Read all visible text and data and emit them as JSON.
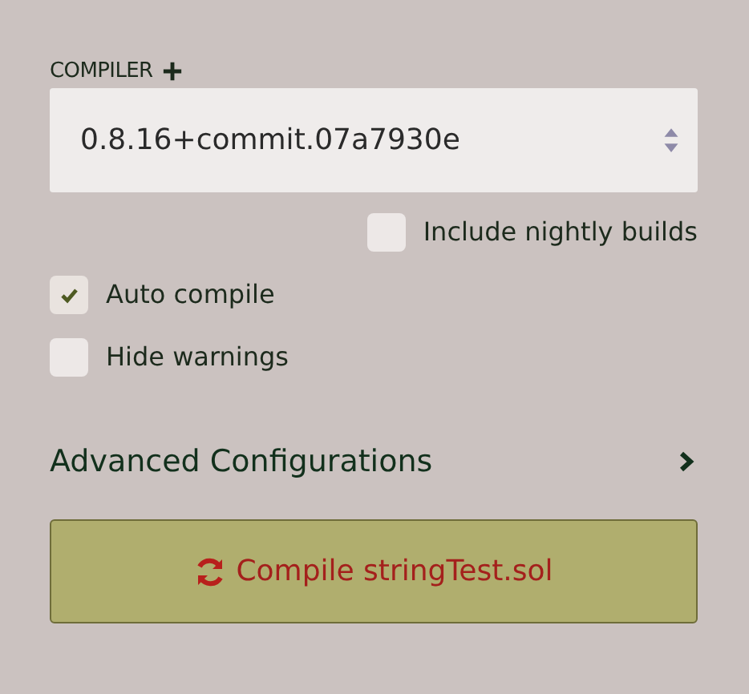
{
  "compiler": {
    "label": "COMPILER",
    "version": "0.8.16+commit.07a7930e"
  },
  "options": [
    {
      "label": "Include nightly builds",
      "checked": false,
      "kind": "aside"
    },
    {
      "label": "Auto compile",
      "checked": true,
      "kind": "main"
    },
    {
      "label": "Hide warnings",
      "checked": false,
      "kind": "main"
    }
  ],
  "advanced": {
    "label": "Advanced Configurations",
    "expanded": false
  },
  "compile_button": {
    "label": "Compile stringTest.sol"
  }
}
